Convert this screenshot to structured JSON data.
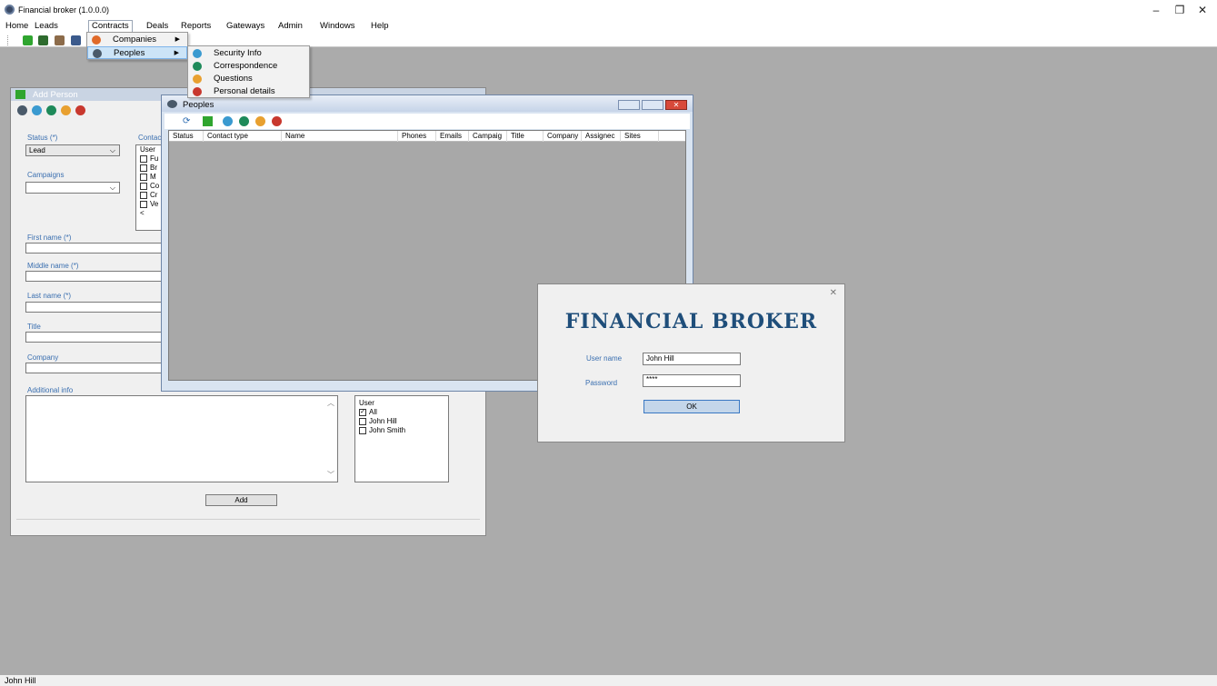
{
  "window": {
    "title": "Financial broker (1.0.0.0)",
    "minimize": "–",
    "maximize": "❐",
    "close": "✕"
  },
  "menu": [
    "Home",
    "Leads",
    "Contracts",
    "Deals",
    "Reports",
    "Gateways",
    "Admin",
    "Windows",
    "Help"
  ],
  "contracts_menu": {
    "companies": "Companies",
    "peoples": "Peoples"
  },
  "peoples_submenu": [
    "Security Info",
    "Correspondence",
    "Questions",
    "Personal details"
  ],
  "add_person": {
    "title": "Add Person",
    "status_label": "Status (*)",
    "status_value": "Lead",
    "contact_label": "Contac",
    "campaigns_label": "Campaigns",
    "contact_list_header": "User",
    "contact_list_items": [
      "Fu",
      "Br",
      "M",
      "Co",
      "Cr",
      "Ve"
    ],
    "first_name_label": "First name (*)",
    "middle_name_label": "Middle name (*)",
    "last_name_label": "Last name (*)",
    "title_label": "Title",
    "company_label": "Company",
    "additional_info_label": "Additional info",
    "user_list_header": "User",
    "user_list": [
      {
        "label": "All",
        "checked": true
      },
      {
        "label": "John Hill",
        "checked": false
      },
      {
        "label": "John Smith",
        "checked": false
      }
    ],
    "add_button": "Add"
  },
  "peoples": {
    "title": "Peoples",
    "columns": [
      "Status",
      "Contact type",
      "Name",
      "Phones",
      "Emails",
      "Campaig",
      "Title",
      "Company",
      "Assignec",
      "Sites"
    ]
  },
  "login": {
    "brand": "FINANCIAL BROKER",
    "user_label": "User name",
    "user_value": "John Hill",
    "password_label": "Password",
    "password_value": "****",
    "ok_button": "OK",
    "close": "✕"
  },
  "status_bar": {
    "user": "John Hill"
  },
  "colors": {
    "label_blue": "#3a6fb0",
    "brand": "#1f4e7a",
    "desktop": "#ababab",
    "highlight": "#cce4f7"
  }
}
